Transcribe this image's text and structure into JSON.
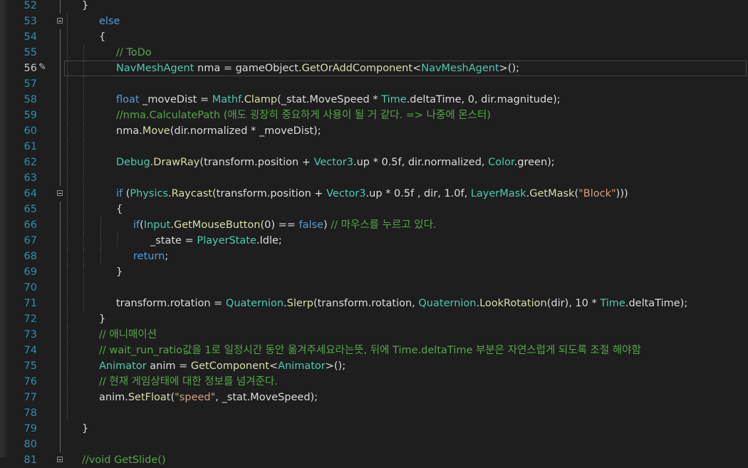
{
  "editor": {
    "lines": [
      {
        "num": "52",
        "indent": 1,
        "fold": false,
        "tokens": [
          {
            "t": "}",
            "c": "pl"
          }
        ],
        "partial": true
      },
      {
        "num": "53",
        "indent": 2,
        "fold": true,
        "tokens": [
          {
            "t": "else",
            "c": "kw"
          }
        ]
      },
      {
        "num": "54",
        "indent": 2,
        "fold": false,
        "tokens": [
          {
            "t": "{",
            "c": "pl"
          }
        ]
      },
      {
        "num": "55",
        "indent": 3,
        "fold": false,
        "tokens": [
          {
            "t": "// ToDo",
            "c": "cm"
          }
        ]
      },
      {
        "num": "56",
        "indent": 3,
        "fold": false,
        "current": true,
        "tokens": [
          {
            "t": "NavMeshAgent",
            "c": "ty"
          },
          {
            "t": " nma = gameObject.",
            "c": "pl"
          },
          {
            "t": "GetOrAddComponent",
            "c": "fn"
          },
          {
            "t": "<",
            "c": "pl"
          },
          {
            "t": "NavMeshAgent",
            "c": "ty"
          },
          {
            "t": ">();",
            "c": "pl"
          }
        ]
      },
      {
        "num": "57",
        "indent": 3,
        "fold": false,
        "tokens": []
      },
      {
        "num": "58",
        "indent": 3,
        "fold": false,
        "tokens": [
          {
            "t": "float",
            "c": "kw"
          },
          {
            "t": " _moveDist = ",
            "c": "pl"
          },
          {
            "t": "Mathf",
            "c": "ty"
          },
          {
            "t": ".",
            "c": "pl"
          },
          {
            "t": "Clamp",
            "c": "fn"
          },
          {
            "t": "(_stat.MoveSpeed * ",
            "c": "pl"
          },
          {
            "t": "Time",
            "c": "ty"
          },
          {
            "t": ".deltaTime, 0, dir.magnitude);",
            "c": "pl"
          }
        ]
      },
      {
        "num": "59",
        "indent": 3,
        "fold": false,
        "tokens": [
          {
            "t": "//nma.CalculatePath (애도 굉장히 중요하게 사용이 될 거 같다. => 나중에 몬스터)",
            "c": "cm"
          }
        ]
      },
      {
        "num": "60",
        "indent": 3,
        "fold": false,
        "tokens": [
          {
            "t": "nma.",
            "c": "pl"
          },
          {
            "t": "Move",
            "c": "fn"
          },
          {
            "t": "(dir.normalized * _moveDist);",
            "c": "pl"
          }
        ]
      },
      {
        "num": "61",
        "indent": 3,
        "fold": false,
        "tokens": []
      },
      {
        "num": "62",
        "indent": 3,
        "fold": false,
        "tokens": [
          {
            "t": "Debug",
            "c": "ty"
          },
          {
            "t": ".",
            "c": "pl"
          },
          {
            "t": "DrawRay",
            "c": "fn"
          },
          {
            "t": "(transform.position + ",
            "c": "pl"
          },
          {
            "t": "Vector3",
            "c": "ty"
          },
          {
            "t": ".up * 0.5f, dir.normalized, ",
            "c": "pl"
          },
          {
            "t": "Color",
            "c": "ty"
          },
          {
            "t": ".green);",
            "c": "pl"
          }
        ]
      },
      {
        "num": "63",
        "indent": 3,
        "fold": false,
        "tokens": []
      },
      {
        "num": "64",
        "indent": 3,
        "fold": true,
        "tokens": [
          {
            "t": "if",
            "c": "kw"
          },
          {
            "t": " (",
            "c": "pl"
          },
          {
            "t": "Physics",
            "c": "ty"
          },
          {
            "t": ".",
            "c": "pl"
          },
          {
            "t": "Raycast",
            "c": "fn"
          },
          {
            "t": "(transform.position + ",
            "c": "pl"
          },
          {
            "t": "Vector3",
            "c": "ty"
          },
          {
            "t": ".up * 0.5f , dir, 1.0f, ",
            "c": "pl"
          },
          {
            "t": "LayerMask",
            "c": "ty"
          },
          {
            "t": ".",
            "c": "pl"
          },
          {
            "t": "GetMask",
            "c": "fn"
          },
          {
            "t": "(",
            "c": "pl"
          },
          {
            "t": "\"Block\"",
            "c": "st"
          },
          {
            "t": ")))",
            "c": "pl"
          }
        ]
      },
      {
        "num": "65",
        "indent": 3,
        "fold": false,
        "tokens": [
          {
            "t": "{",
            "c": "pl"
          }
        ]
      },
      {
        "num": "66",
        "indent": 4,
        "fold": false,
        "tokens": [
          {
            "t": "if",
            "c": "kw"
          },
          {
            "t": "(",
            "c": "pl"
          },
          {
            "t": "Input",
            "c": "ty"
          },
          {
            "t": ".",
            "c": "pl"
          },
          {
            "t": "GetMouseButton",
            "c": "fn"
          },
          {
            "t": "(0) == ",
            "c": "pl"
          },
          {
            "t": "false",
            "c": "kw"
          },
          {
            "t": ") ",
            "c": "pl"
          },
          {
            "t": "// 마우스를 누르고 있다.",
            "c": "cm"
          }
        ]
      },
      {
        "num": "67",
        "indent": 5,
        "fold": false,
        "tokens": [
          {
            "t": "_state = ",
            "c": "pl"
          },
          {
            "t": "PlayerState",
            "c": "ty"
          },
          {
            "t": ".Idle;",
            "c": "pl"
          }
        ]
      },
      {
        "num": "68",
        "indent": 4,
        "fold": false,
        "tokens": [
          {
            "t": "return",
            "c": "kw"
          },
          {
            "t": ";",
            "c": "pl"
          }
        ]
      },
      {
        "num": "69",
        "indent": 3,
        "fold": false,
        "tokens": [
          {
            "t": "}",
            "c": "pl"
          }
        ]
      },
      {
        "num": "70",
        "indent": 3,
        "fold": false,
        "tokens": []
      },
      {
        "num": "71",
        "indent": 3,
        "fold": false,
        "tokens": [
          {
            "t": "transform.rotation = ",
            "c": "pl"
          },
          {
            "t": "Quaternion",
            "c": "ty"
          },
          {
            "t": ".",
            "c": "pl"
          },
          {
            "t": "Slerp",
            "c": "fn"
          },
          {
            "t": "(transform.rotation, ",
            "c": "pl"
          },
          {
            "t": "Quaternion",
            "c": "ty"
          },
          {
            "t": ".",
            "c": "pl"
          },
          {
            "t": "LookRotation",
            "c": "fn"
          },
          {
            "t": "(dir), 10 * ",
            "c": "pl"
          },
          {
            "t": "Time",
            "c": "ty"
          },
          {
            "t": ".deltaTime);",
            "c": "pl"
          }
        ]
      },
      {
        "num": "72",
        "indent": 2,
        "fold": false,
        "tokens": [
          {
            "t": "}",
            "c": "pl"
          }
        ]
      },
      {
        "num": "73",
        "indent": 2,
        "fold": false,
        "tokens": [
          {
            "t": "// 애니매이션",
            "c": "cm"
          }
        ]
      },
      {
        "num": "74",
        "indent": 2,
        "fold": false,
        "tokens": [
          {
            "t": "// wait_run_ratio값을 1로 일정시간 동안 옮겨주세요라는뜻, 뒤에 Time.deltaTime 부분은 자연스럽게 되도록 조절 해야함",
            "c": "cm"
          }
        ]
      },
      {
        "num": "75",
        "indent": 2,
        "fold": false,
        "tokens": [
          {
            "t": "Animator",
            "c": "ty"
          },
          {
            "t": " anim = ",
            "c": "pl"
          },
          {
            "t": "GetComponent",
            "c": "fn"
          },
          {
            "t": "<",
            "c": "pl"
          },
          {
            "t": "Animator",
            "c": "ty"
          },
          {
            "t": ">();",
            "c": "pl"
          }
        ]
      },
      {
        "num": "76",
        "indent": 2,
        "fold": false,
        "tokens": [
          {
            "t": "// 현재 게임상태에 대한 정보를 넘겨준다.",
            "c": "cm"
          }
        ]
      },
      {
        "num": "77",
        "indent": 2,
        "fold": false,
        "tokens": [
          {
            "t": "anim.",
            "c": "pl"
          },
          {
            "t": "SetFloat",
            "c": "fn"
          },
          {
            "t": "(",
            "c": "pl"
          },
          {
            "t": "\"speed\"",
            "c": "st"
          },
          {
            "t": ", _stat.MoveSpeed);",
            "c": "pl"
          }
        ]
      },
      {
        "num": "78",
        "indent": 2,
        "fold": false,
        "tokens": []
      },
      {
        "num": "79",
        "indent": 1,
        "fold": false,
        "tokens": [
          {
            "t": "}",
            "c": "pl"
          }
        ]
      },
      {
        "num": "80",
        "indent": 1,
        "fold": false,
        "tokens": []
      },
      {
        "num": "81",
        "indent": 1,
        "fold": true,
        "tokens": [
          {
            "t": "//void GetSlide()",
            "c": "cm"
          }
        ]
      }
    ]
  },
  "icons": {
    "edit_marker": "pencil-icon"
  }
}
